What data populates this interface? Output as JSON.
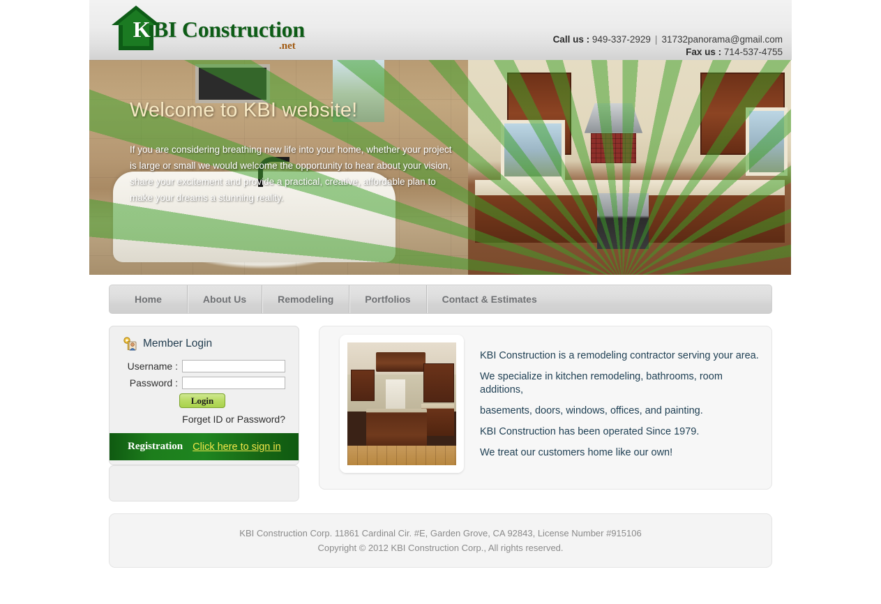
{
  "header": {
    "logo": {
      "mark_letter": "K",
      "name": "BI Construction",
      "tld": ".net",
      "green": "#0d5c16",
      "tld_color": "#a05a12"
    },
    "contact": {
      "call_label": "Call us :",
      "phone": "949-337-2929",
      "separator": "|",
      "email": "31732panorama@gmail.com",
      "fax_label": "Fax us :",
      "fax": "714-537-4755"
    }
  },
  "hero": {
    "title": "Welcome to KBI website!",
    "body": "If you are considering breathing new life into your home, whether your project is large or small we would welcome the opportunity to hear about your vision, share your excitement and provide a practical, creative, affordable plan to make your dreams a stunning reality.",
    "title_color": "#f7e9c4",
    "body_color": "#ffffff",
    "ray_color": "#3ca028"
  },
  "nav": {
    "items": [
      {
        "label": "Home"
      },
      {
        "label": "About Us"
      },
      {
        "label": "Remodeling"
      },
      {
        "label": "Portfolios"
      },
      {
        "label": "Contact & Estimates"
      }
    ]
  },
  "login": {
    "icon": "key-user-icon",
    "title": "Member Login",
    "username_label": "Username :",
    "username_value": "",
    "username_placeholder": "",
    "password_label": "Password :",
    "password_value": "",
    "password_placeholder": "",
    "login_button": "Login",
    "forgot_link": "Forget ID or Password?",
    "registration_label": "Registration",
    "registration_link": "Click here to sign in",
    "registration_bg": "#1f8520",
    "registration_link_color": "#f2e64a"
  },
  "main": {
    "thumbnail_alt": "kitchen-remodel-photo",
    "paragraphs": [
      "KBI Construction is a remodeling contractor serving your area.",
      "We specialize in kitchen remodeling, bathrooms, room additions,",
      "basements, doors, windows, offices, and painting.",
      "KBI Construction has been operated Since 1979.",
      "We treat our customers home like our own!"
    ],
    "text_color": "#1d3e52"
  },
  "footer": {
    "address": "KBI Construction Corp. 11861 Cardinal Cir. #E, Garden Grove, CA 92843, License Number #915106",
    "copyright": "Copyright © 2012 KBI Construction Corp., All rights reserved."
  }
}
